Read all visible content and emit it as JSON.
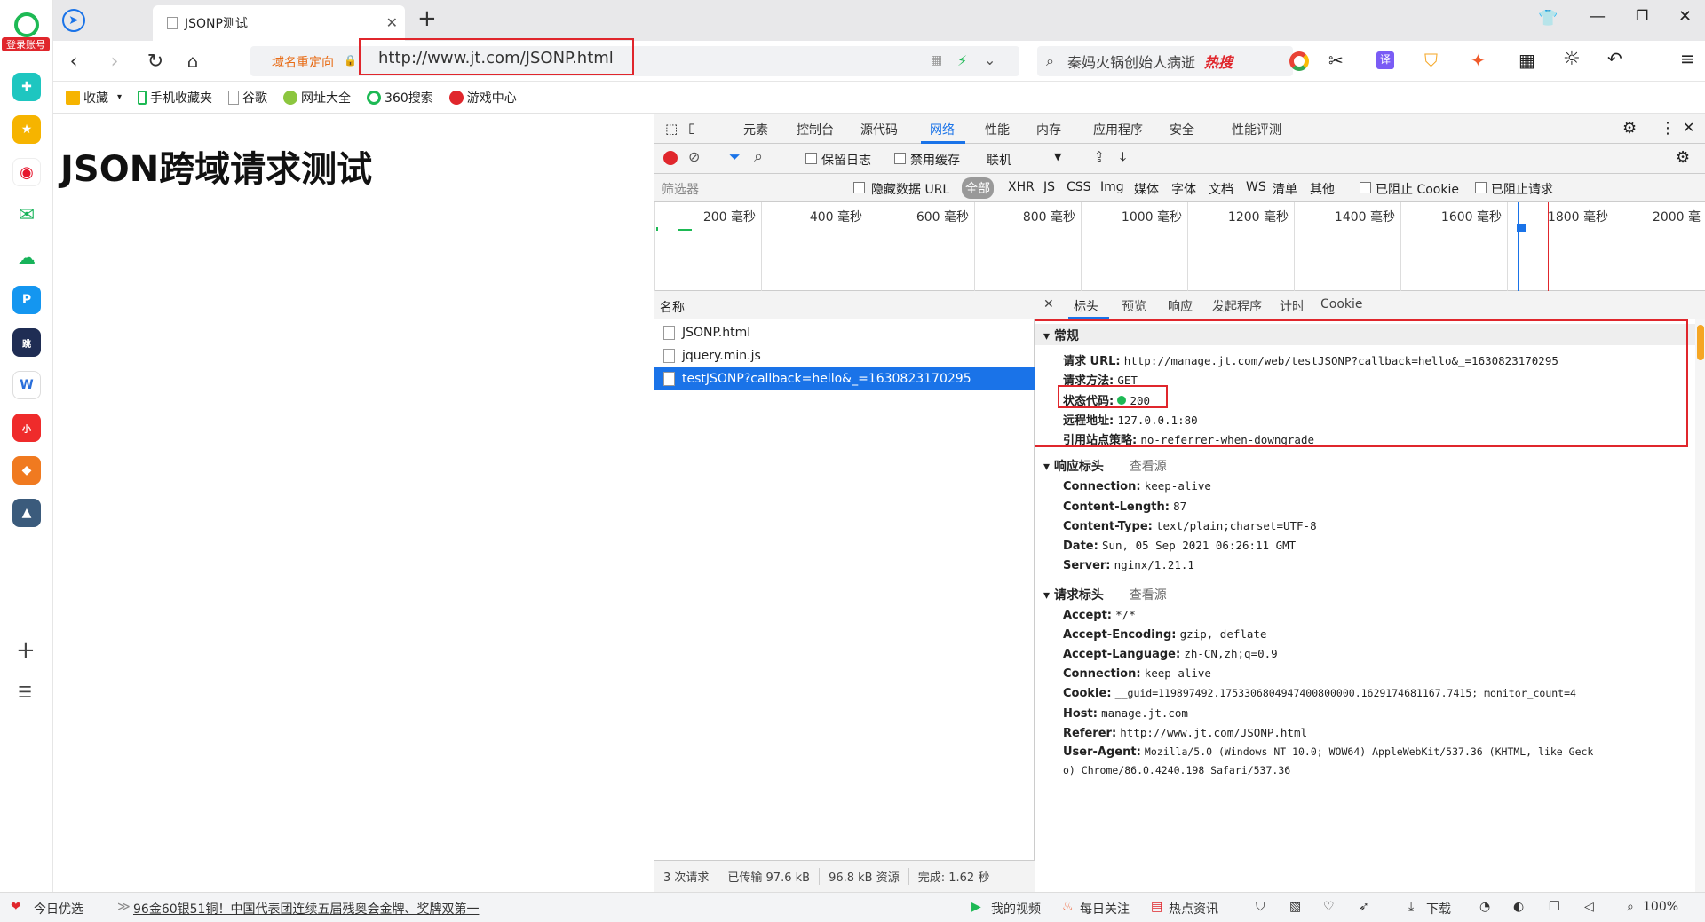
{
  "browser": {
    "tab_title": "JSONP测试",
    "url_redirect_label": "域名重定向",
    "url": "http://www.jt.com/JSONP.html",
    "search_text": "秦妈火锅创始人病逝",
    "search_badge": "热搜",
    "login_label": "登录账号"
  },
  "bookmarks": [
    {
      "label": "收藏"
    },
    {
      "label": "手机收藏夹"
    },
    {
      "label": "谷歌"
    },
    {
      "label": "网址大全"
    },
    {
      "label": "360搜索"
    },
    {
      "label": "游戏中心"
    }
  ],
  "page": {
    "title": "JSON跨域请求测试"
  },
  "devtools": {
    "tabs": [
      "元素",
      "控制台",
      "源代码",
      "网络",
      "性能",
      "内存",
      "应用程序",
      "安全",
      "性能评测"
    ],
    "active_tab": "网络",
    "controls": {
      "preserve_log": "保留日志",
      "disable_cache": "禁用缓存",
      "throttle": "联机"
    },
    "filter": {
      "placeholder": "筛选器",
      "hide_data_url": "隐藏数据 URL",
      "types": [
        "全部",
        "XHR",
        "JS",
        "CSS",
        "Img",
        "媒体",
        "字体",
        "文档",
        "WS",
        "清单",
        "其他"
      ],
      "blocked_cookie": "已阻止 Cookie",
      "blocked_request": "已阻止请求"
    },
    "timeline_ticks": [
      "200 毫秒",
      "400 毫秒",
      "600 毫秒",
      "800 毫秒",
      "1000 毫秒",
      "1200 毫秒",
      "1400 毫秒",
      "1600 毫秒",
      "1800 毫秒",
      "2000 毫"
    ],
    "list_header": "名称",
    "requests": [
      {
        "name": "JSONP.html"
      },
      {
        "name": "jquery.min.js"
      },
      {
        "name": "testJSONP?callback=hello&_=1630823170295"
      }
    ],
    "status": {
      "requests": "3 次请求",
      "transferred": "已传输 97.6 kB",
      "resources": "96.8 kB 资源",
      "finish": "完成: 1.62 秒"
    },
    "detail_tabs": [
      "标头",
      "预览",
      "响应",
      "发起程序",
      "计时",
      "Cookie"
    ],
    "general": {
      "title": "常规",
      "request_url_k": "请求 URL:",
      "request_url_v": "http://manage.jt.com/web/testJSONP?callback=hello&_=1630823170295",
      "method_k": "请求方法:",
      "method_v": "GET",
      "status_k": "状态代码:",
      "status_v": "200",
      "remote_k": "远程地址:",
      "remote_v": "127.0.0.1:80",
      "policy_k": "引用站点策略:",
      "policy_v": "no-referrer-when-downgrade"
    },
    "response_headers": {
      "title": "响应标头",
      "view_source": "查看源",
      "items": [
        {
          "k": "Connection:",
          "v": "keep-alive"
        },
        {
          "k": "Content-Length:",
          "v": "87"
        },
        {
          "k": "Content-Type:",
          "v": "text/plain;charset=UTF-8"
        },
        {
          "k": "Date:",
          "v": "Sun, 05 Sep 2021 06:26:11 GMT"
        },
        {
          "k": "Server:",
          "v": "nginx/1.21.1"
        }
      ]
    },
    "request_headers": {
      "title": "请求标头",
      "view_source": "查看源",
      "items": [
        {
          "k": "Accept:",
          "v": "*/*"
        },
        {
          "k": "Accept-Encoding:",
          "v": "gzip, deflate"
        },
        {
          "k": "Accept-Language:",
          "v": "zh-CN,zh;q=0.9"
        },
        {
          "k": "Connection:",
          "v": "keep-alive"
        },
        {
          "k": "Cookie:",
          "v": "__guid=119897492.1753306804947400800000.1629174681167.7415; monitor_count=4"
        },
        {
          "k": "Host:",
          "v": "manage.jt.com"
        },
        {
          "k": "Referer:",
          "v": "http://www.jt.com/JSONP.html"
        },
        {
          "k": "User-Agent:",
          "v": "Mozilla/5.0 (Windows NT 10.0; WOW64) AppleWebKit/537.36 (KHTML, like Geck"
        },
        {
          "k": "",
          "v": "o) Chrome/86.0.4240.198 Safari/537.36"
        }
      ]
    }
  },
  "bottom": {
    "daily": "今日优选",
    "news": "96金60银51铜！中国代表团连续五届残奥会金牌、奖牌双第一",
    "video": "我的视频",
    "follow": "每日关注",
    "hot": "热点资讯",
    "download": "下载",
    "zoom": "100%"
  },
  "colors": {
    "accent": "#1a73e8",
    "highlight": "#e0262c",
    "status_ok": "#1db954"
  }
}
